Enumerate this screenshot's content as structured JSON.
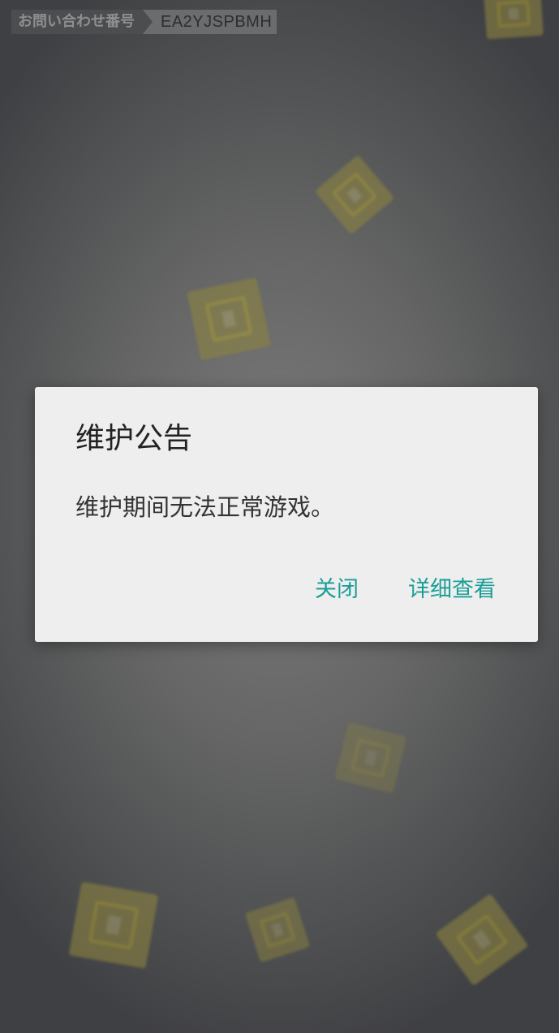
{
  "inquiry": {
    "label": "お問い合わせ番号",
    "code": "EA2YJSPBMH"
  },
  "dialog": {
    "title": "维护公告",
    "message": "维护期间无法正常游戏。",
    "close_label": "关闭",
    "details_label": "详细查看"
  },
  "colors": {
    "accent": "#199e97",
    "dialog_background": "#eeeeee",
    "deco_yellow": "#8c8340"
  },
  "decorations": {
    "icon": "yellow-box-icon",
    "count": 8
  }
}
